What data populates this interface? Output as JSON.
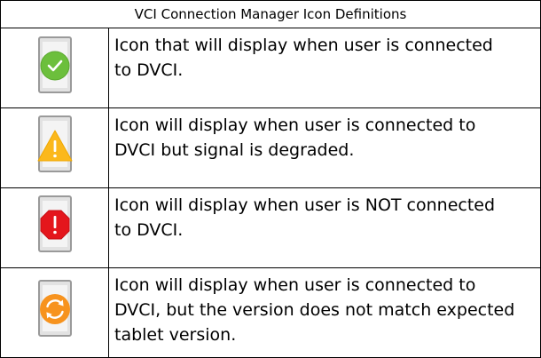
{
  "table": {
    "title": "VCI Connection Manager Icon Definitions",
    "rows": [
      {
        "icon": "connected-check-icon",
        "icon_color": "#6cbf3c",
        "lines": [
          "Icon that will display when user is connected",
          "to DVCI."
        ]
      },
      {
        "icon": "degraded-warning-icon",
        "icon_color": "#fbb81c",
        "lines": [
          "Icon will display when user is connected to",
          "DVCI but signal is degraded."
        ]
      },
      {
        "icon": "not-connected-stop-icon",
        "icon_color": "#e4161c",
        "lines": [
          "Icon will display when user is NOT connected",
          "to DVCI."
        ]
      },
      {
        "icon": "version-mismatch-sync-icon",
        "icon_color": "#f7931e",
        "lines": [
          "Icon will display when user is connected to",
          "DVCI, but the version does not match expected",
          "tablet version."
        ]
      }
    ]
  }
}
